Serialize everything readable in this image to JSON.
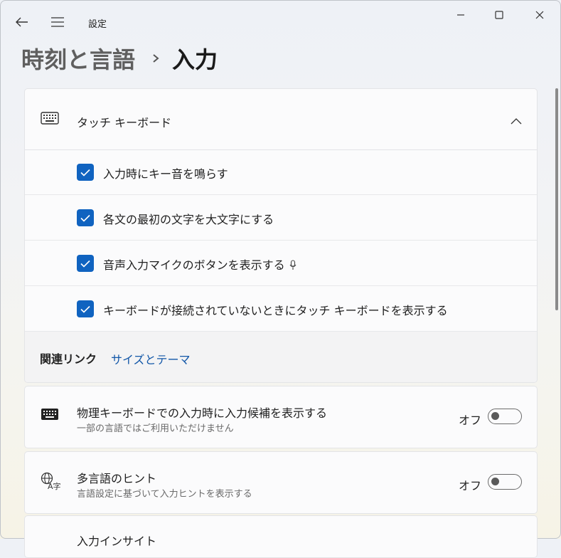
{
  "window": {
    "app_title": "設定",
    "controls": {
      "minimize": "minimize-icon",
      "maximize": "maximize-icon",
      "close": "close-icon"
    }
  },
  "nav": {
    "back_icon": "back-arrow-icon",
    "menu_icon": "hamburger-menu-icon"
  },
  "breadcrumb": {
    "parent": "時刻と言語",
    "current": "入力"
  },
  "touch_keyboard": {
    "title": "タッチ キーボード",
    "expanded": true,
    "options": [
      {
        "label": "入力時にキー音を鳴らす",
        "checked": true
      },
      {
        "label": "各文の最初の文字を大文字にする",
        "checked": true
      },
      {
        "label": "音声入力マイクのボタンを表示する",
        "checked": true,
        "icon": "microphone-icon"
      },
      {
        "label": "キーボードが接続されていないときにタッチ キーボードを表示する",
        "checked": true
      }
    ],
    "related": {
      "title": "関連リンク",
      "link": "サイズとテーマ"
    }
  },
  "settings": [
    {
      "title": "物理キーボードでの入力時に入力候補を表示する",
      "subtitle": "一部の言語ではご利用いただけません",
      "state": "オフ",
      "on": false,
      "icon": "keyboard-icon"
    },
    {
      "title": "多言語のヒント",
      "subtitle": "言語設定に基づいて入力ヒントを表示する",
      "state": "オフ",
      "on": false,
      "icon": "language-icon"
    }
  ],
  "partial": {
    "title": "入力インサイト"
  },
  "colors": {
    "accent": "#1063c0",
    "link": "#1257a8"
  }
}
